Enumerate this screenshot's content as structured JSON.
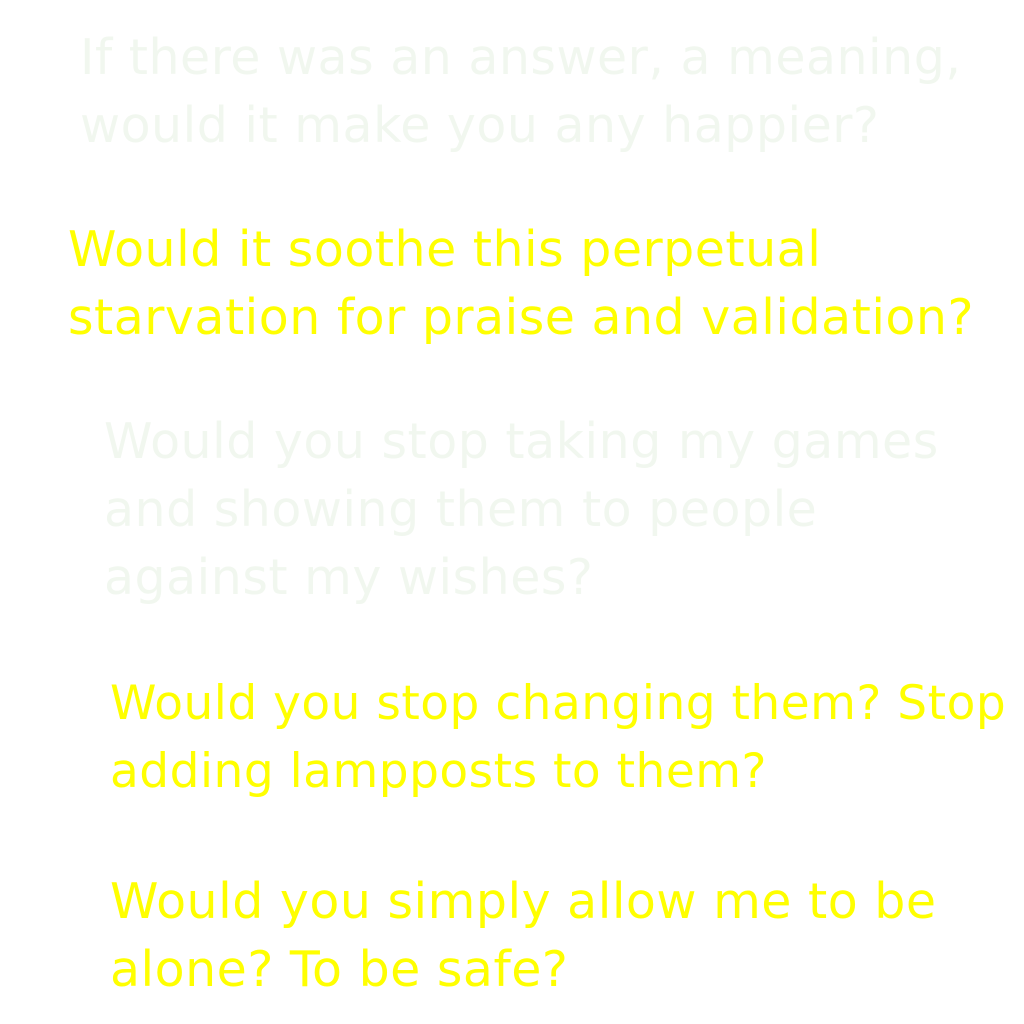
{
  "colors": {
    "background": "#ffffff",
    "faint_text": "#f1f7ef",
    "highlight_text": "#ffff00"
  },
  "paragraphs": [
    {
      "lines": [
        "If there was an answer, a meaning,",
        "would it make you any happier?"
      ]
    },
    {
      "lines": [
        "Would it soothe this perpetual",
        "starvation for praise and validation?"
      ]
    },
    {
      "lines": [
        "Would you stop taking my games",
        "and showing them to people",
        "against my wishes?"
      ]
    },
    {
      "lines": [
        "Would you stop changing them? Stop",
        "adding lampposts to them?"
      ]
    },
    {
      "lines": [
        "Would you simply allow me to be",
        "alone? To be safe?"
      ]
    }
  ]
}
